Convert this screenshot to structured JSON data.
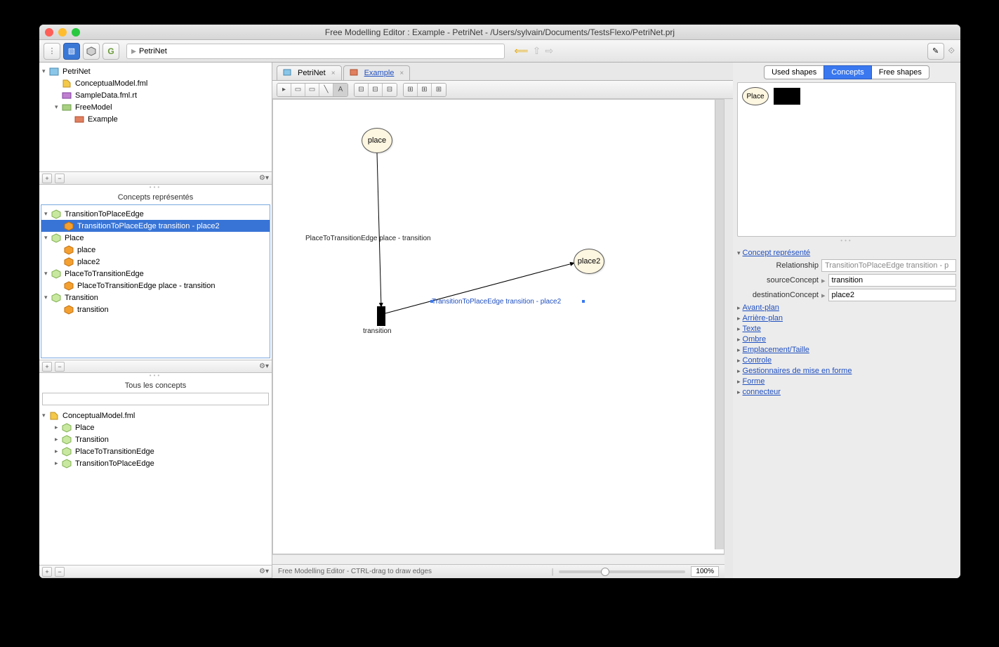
{
  "window": {
    "title": "Free Modelling Editor : Example - PetriNet - /Users/sylvain/Documents/TestsFlexo/PetriNet.prj"
  },
  "breadcrumb": {
    "value": "PetriNet"
  },
  "projectTree": {
    "root": "PetriNet",
    "conceptual": "ConceptualModel.fml",
    "sampledata": "SampleData.fml.rt",
    "freemodel": "FreeModel",
    "example": "Example"
  },
  "conceptsPanel": {
    "title": "Concepts représentés",
    "items": [
      {
        "label": "TransitionToPlaceEdge",
        "children": [
          {
            "label": "TransitionToPlaceEdge transition - place2",
            "selected": true
          }
        ]
      },
      {
        "label": "Place",
        "children": [
          {
            "label": "place"
          },
          {
            "label": "place2"
          }
        ]
      },
      {
        "label": "PlaceToTransitionEdge",
        "children": [
          {
            "label": "PlaceToTransitionEdge place - transition"
          }
        ]
      },
      {
        "label": "Transition",
        "children": [
          {
            "label": "transition"
          }
        ]
      }
    ]
  },
  "allConceptsPanel": {
    "title": "Tous les concepts",
    "root": "ConceptualModel.fml",
    "items": [
      "Place",
      "Transition",
      "PlaceToTransitionEdge",
      "TransitionToPlaceEdge"
    ]
  },
  "tabs": {
    "petri": "PetriNet",
    "example": "Example"
  },
  "canvas": {
    "place": "place",
    "place2": "place2",
    "transition": "transition",
    "edge1": "PlaceToTransitionEdge place - transition",
    "edge2": "TransitionToPlaceEdge transition - place2"
  },
  "statusbar": {
    "msg": "Free Modelling Editor - CTRL-drag to draw edges",
    "zoom": "100%"
  },
  "rightTabs": {
    "used": "Used shapes",
    "concepts": "Concepts",
    "free": "Free shapes"
  },
  "palette": {
    "place": "Place"
  },
  "propsHeader": "Concept représenté",
  "propRows": {
    "relationship": {
      "label": "Relationship",
      "value": "TransitionToPlaceEdge transition - p"
    },
    "sourceConcept": {
      "label": "sourceConcept",
      "value": "transition"
    },
    "destinationConcept": {
      "label": "destinationConcept",
      "value": "place2"
    }
  },
  "propSections": [
    "Avant-plan",
    "Arrière-plan",
    "Texte",
    "Ombre",
    "Emplacement/Taille",
    "Controle",
    "Gestionnaires de mise en forme",
    "Forme",
    "connecteur"
  ]
}
